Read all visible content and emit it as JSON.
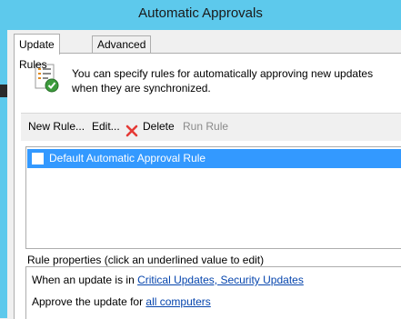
{
  "window": {
    "title": "Automatic Approvals"
  },
  "tabs": [
    {
      "label": "Update Rules",
      "active": true
    },
    {
      "label": "Advanced",
      "active": false
    }
  ],
  "intro": {
    "icon": "checklist-approved-icon",
    "text": "You can specify rules for automatically approving new updates when they are synchronized."
  },
  "toolbar": {
    "new_rule": "New Rule...",
    "edit": "Edit...",
    "delete": "Delete",
    "run_rule": "Run Rule"
  },
  "rules": [
    {
      "label": "Default Automatic Approval Rule",
      "checked": false,
      "selected": true
    }
  ],
  "properties": {
    "heading": "Rule properties (click an underlined value to edit)",
    "line1_prefix": "When an update is in ",
    "line1_link": "Critical Updates, Security Updates",
    "line2_prefix": "Approve the update for ",
    "line2_link": "all computers"
  },
  "colors": {
    "titlebar": "#5dc9ec",
    "selection": "#3399ff",
    "link": "#0645ad",
    "delete_x": "#e53935"
  }
}
